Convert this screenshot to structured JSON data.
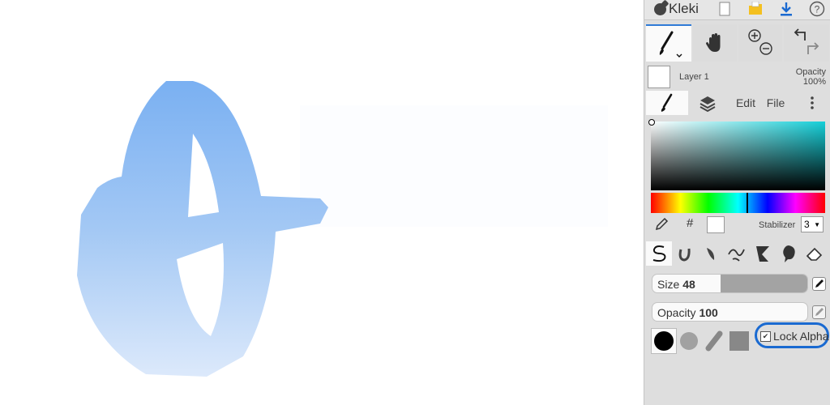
{
  "app": {
    "name": "Kleki"
  },
  "colors": {
    "accent": "#2f7bd6",
    "annotation": "#1a6ad1",
    "stroke": "#7ab0f2",
    "picker_hue": "#14cfd8",
    "primary_color": "#ffffff"
  },
  "toolbar": {
    "icons": [
      "new-image-icon",
      "open-folder-icon",
      "download-icon",
      "help-icon"
    ],
    "help_label": "?"
  },
  "tools": [
    "brush-tool-icon",
    "hand-tool-icon",
    "zoom-in-icon",
    "zoom-out-icon",
    "undo-icon",
    "redo-icon"
  ],
  "layer": {
    "name": "Layer 1",
    "opacity_label": "Opacity",
    "opacity_value": "100%"
  },
  "tabs": [
    {
      "id": "brush",
      "icon": "brush-tab-icon"
    },
    {
      "id": "layers",
      "icon": "layers-tab-icon"
    },
    {
      "id": "edit",
      "label": "Edit"
    },
    {
      "id": "file",
      "label": "File"
    }
  ],
  "color_row": {
    "hex_symbol": "#",
    "stabilizer_label": "Stabilizer",
    "stabilizer_value": "3"
  },
  "brushes": [
    "pen-brush-icon",
    "blend-brush-icon",
    "sketchy-brush-icon",
    "pixel-brush-icon",
    "chemy-brush-icon",
    "smudge-brush-icon",
    "eraser-icon"
  ],
  "size": {
    "label": "Size",
    "value": "48",
    "fill": 0.48
  },
  "opacity": {
    "label": "Opacity",
    "value": "100",
    "fill": 1.0
  },
  "shapes": [
    "round-solid-shape-icon",
    "round-soft-shape-icon",
    "chalk-shape-icon",
    "square-shape-icon"
  ],
  "lock_alpha": {
    "label": "Lock Alpha",
    "checked": true,
    "check_glyph": "✔"
  }
}
